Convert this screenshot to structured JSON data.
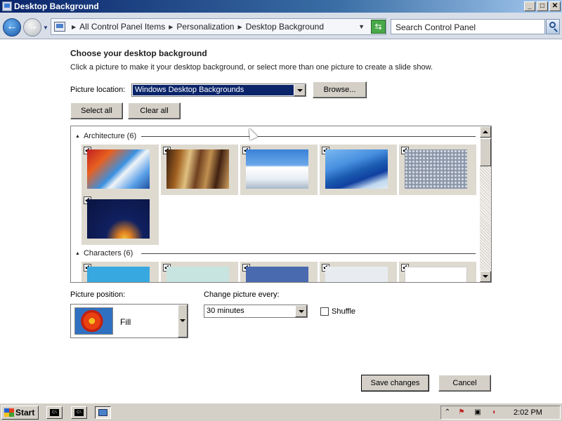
{
  "window": {
    "title": "Desktop Background",
    "buttons": {
      "minimize": "_",
      "maximize": "□",
      "close": "✕"
    }
  },
  "addressbar": {
    "breadcrumbs": [
      "All Control Panel Items",
      "Personalization",
      "Desktop Background"
    ],
    "search_placeholder": "Search Control Panel"
  },
  "main": {
    "heading": "Choose your desktop background",
    "description": "Click a picture to make it your desktop background, or select more than one picture to create a slide show.",
    "picture_location_label": "Picture location:",
    "picture_location_value": "Windows Desktop Backgrounds",
    "browse_label": "Browse...",
    "select_all_label": "Select all",
    "clear_all_label": "Clear all"
  },
  "gallery": {
    "groups": [
      {
        "name": "Architecture (6)",
        "count": 6,
        "checked": [
          true,
          true,
          true,
          true,
          true,
          true
        ]
      },
      {
        "name": "Characters (6)",
        "count": 6,
        "checked": [
          true,
          true,
          true,
          true,
          true,
          true
        ]
      }
    ]
  },
  "position": {
    "label": "Picture position:",
    "value": "Fill"
  },
  "slideshow": {
    "label": "Change picture every:",
    "value": "30 minutes",
    "shuffle_label": "Shuffle",
    "shuffle_checked": false
  },
  "actions": {
    "save_label": "Save changes",
    "cancel_label": "Cancel"
  },
  "taskbar": {
    "start_label": "Start",
    "clock": "2:02 PM"
  }
}
